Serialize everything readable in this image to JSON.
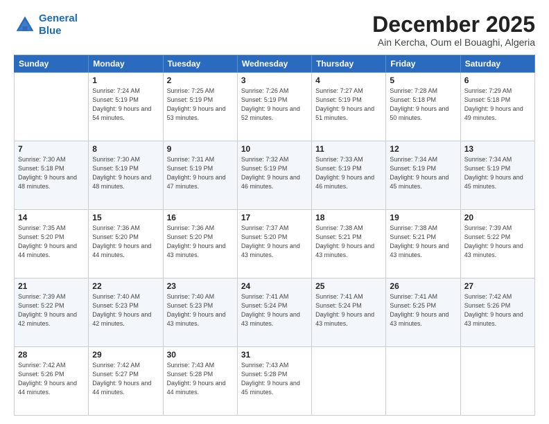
{
  "logo": {
    "line1": "General",
    "line2": "Blue"
  },
  "header": {
    "month": "December 2025",
    "location": "Ain Kercha, Oum el Bouaghi, Algeria"
  },
  "weekdays": [
    "Sunday",
    "Monday",
    "Tuesday",
    "Wednesday",
    "Thursday",
    "Friday",
    "Saturday"
  ],
  "weeks": [
    [
      {
        "day": "",
        "sunrise": "",
        "sunset": "",
        "daylight": ""
      },
      {
        "day": "1",
        "sunrise": "Sunrise: 7:24 AM",
        "sunset": "Sunset: 5:19 PM",
        "daylight": "Daylight: 9 hours and 54 minutes."
      },
      {
        "day": "2",
        "sunrise": "Sunrise: 7:25 AM",
        "sunset": "Sunset: 5:19 PM",
        "daylight": "Daylight: 9 hours and 53 minutes."
      },
      {
        "day": "3",
        "sunrise": "Sunrise: 7:26 AM",
        "sunset": "Sunset: 5:19 PM",
        "daylight": "Daylight: 9 hours and 52 minutes."
      },
      {
        "day": "4",
        "sunrise": "Sunrise: 7:27 AM",
        "sunset": "Sunset: 5:19 PM",
        "daylight": "Daylight: 9 hours and 51 minutes."
      },
      {
        "day": "5",
        "sunrise": "Sunrise: 7:28 AM",
        "sunset": "Sunset: 5:18 PM",
        "daylight": "Daylight: 9 hours and 50 minutes."
      },
      {
        "day": "6",
        "sunrise": "Sunrise: 7:29 AM",
        "sunset": "Sunset: 5:18 PM",
        "daylight": "Daylight: 9 hours and 49 minutes."
      }
    ],
    [
      {
        "day": "7",
        "sunrise": "Sunrise: 7:30 AM",
        "sunset": "Sunset: 5:18 PM",
        "daylight": "Daylight: 9 hours and 48 minutes."
      },
      {
        "day": "8",
        "sunrise": "Sunrise: 7:30 AM",
        "sunset": "Sunset: 5:19 PM",
        "daylight": "Daylight: 9 hours and 48 minutes."
      },
      {
        "day": "9",
        "sunrise": "Sunrise: 7:31 AM",
        "sunset": "Sunset: 5:19 PM",
        "daylight": "Daylight: 9 hours and 47 minutes."
      },
      {
        "day": "10",
        "sunrise": "Sunrise: 7:32 AM",
        "sunset": "Sunset: 5:19 PM",
        "daylight": "Daylight: 9 hours and 46 minutes."
      },
      {
        "day": "11",
        "sunrise": "Sunrise: 7:33 AM",
        "sunset": "Sunset: 5:19 PM",
        "daylight": "Daylight: 9 hours and 46 minutes."
      },
      {
        "day": "12",
        "sunrise": "Sunrise: 7:34 AM",
        "sunset": "Sunset: 5:19 PM",
        "daylight": "Daylight: 9 hours and 45 minutes."
      },
      {
        "day": "13",
        "sunrise": "Sunrise: 7:34 AM",
        "sunset": "Sunset: 5:19 PM",
        "daylight": "Daylight: 9 hours and 45 minutes."
      }
    ],
    [
      {
        "day": "14",
        "sunrise": "Sunrise: 7:35 AM",
        "sunset": "Sunset: 5:20 PM",
        "daylight": "Daylight: 9 hours and 44 minutes."
      },
      {
        "day": "15",
        "sunrise": "Sunrise: 7:36 AM",
        "sunset": "Sunset: 5:20 PM",
        "daylight": "Daylight: 9 hours and 44 minutes."
      },
      {
        "day": "16",
        "sunrise": "Sunrise: 7:36 AM",
        "sunset": "Sunset: 5:20 PM",
        "daylight": "Daylight: 9 hours and 43 minutes."
      },
      {
        "day": "17",
        "sunrise": "Sunrise: 7:37 AM",
        "sunset": "Sunset: 5:20 PM",
        "daylight": "Daylight: 9 hours and 43 minutes."
      },
      {
        "day": "18",
        "sunrise": "Sunrise: 7:38 AM",
        "sunset": "Sunset: 5:21 PM",
        "daylight": "Daylight: 9 hours and 43 minutes."
      },
      {
        "day": "19",
        "sunrise": "Sunrise: 7:38 AM",
        "sunset": "Sunset: 5:21 PM",
        "daylight": "Daylight: 9 hours and 43 minutes."
      },
      {
        "day": "20",
        "sunrise": "Sunrise: 7:39 AM",
        "sunset": "Sunset: 5:22 PM",
        "daylight": "Daylight: 9 hours and 43 minutes."
      }
    ],
    [
      {
        "day": "21",
        "sunrise": "Sunrise: 7:39 AM",
        "sunset": "Sunset: 5:22 PM",
        "daylight": "Daylight: 9 hours and 42 minutes."
      },
      {
        "day": "22",
        "sunrise": "Sunrise: 7:40 AM",
        "sunset": "Sunset: 5:23 PM",
        "daylight": "Daylight: 9 hours and 42 minutes."
      },
      {
        "day": "23",
        "sunrise": "Sunrise: 7:40 AM",
        "sunset": "Sunset: 5:23 PM",
        "daylight": "Daylight: 9 hours and 43 minutes."
      },
      {
        "day": "24",
        "sunrise": "Sunrise: 7:41 AM",
        "sunset": "Sunset: 5:24 PM",
        "daylight": "Daylight: 9 hours and 43 minutes."
      },
      {
        "day": "25",
        "sunrise": "Sunrise: 7:41 AM",
        "sunset": "Sunset: 5:24 PM",
        "daylight": "Daylight: 9 hours and 43 minutes."
      },
      {
        "day": "26",
        "sunrise": "Sunrise: 7:41 AM",
        "sunset": "Sunset: 5:25 PM",
        "daylight": "Daylight: 9 hours and 43 minutes."
      },
      {
        "day": "27",
        "sunrise": "Sunrise: 7:42 AM",
        "sunset": "Sunset: 5:26 PM",
        "daylight": "Daylight: 9 hours and 43 minutes."
      }
    ],
    [
      {
        "day": "28",
        "sunrise": "Sunrise: 7:42 AM",
        "sunset": "Sunset: 5:26 PM",
        "daylight": "Daylight: 9 hours and 44 minutes."
      },
      {
        "day": "29",
        "sunrise": "Sunrise: 7:42 AM",
        "sunset": "Sunset: 5:27 PM",
        "daylight": "Daylight: 9 hours and 44 minutes."
      },
      {
        "day": "30",
        "sunrise": "Sunrise: 7:43 AM",
        "sunset": "Sunset: 5:28 PM",
        "daylight": "Daylight: 9 hours and 44 minutes."
      },
      {
        "day": "31",
        "sunrise": "Sunrise: 7:43 AM",
        "sunset": "Sunset: 5:28 PM",
        "daylight": "Daylight: 9 hours and 45 minutes."
      },
      {
        "day": "",
        "sunrise": "",
        "sunset": "",
        "daylight": ""
      },
      {
        "day": "",
        "sunrise": "",
        "sunset": "",
        "daylight": ""
      },
      {
        "day": "",
        "sunrise": "",
        "sunset": "",
        "daylight": ""
      }
    ]
  ]
}
